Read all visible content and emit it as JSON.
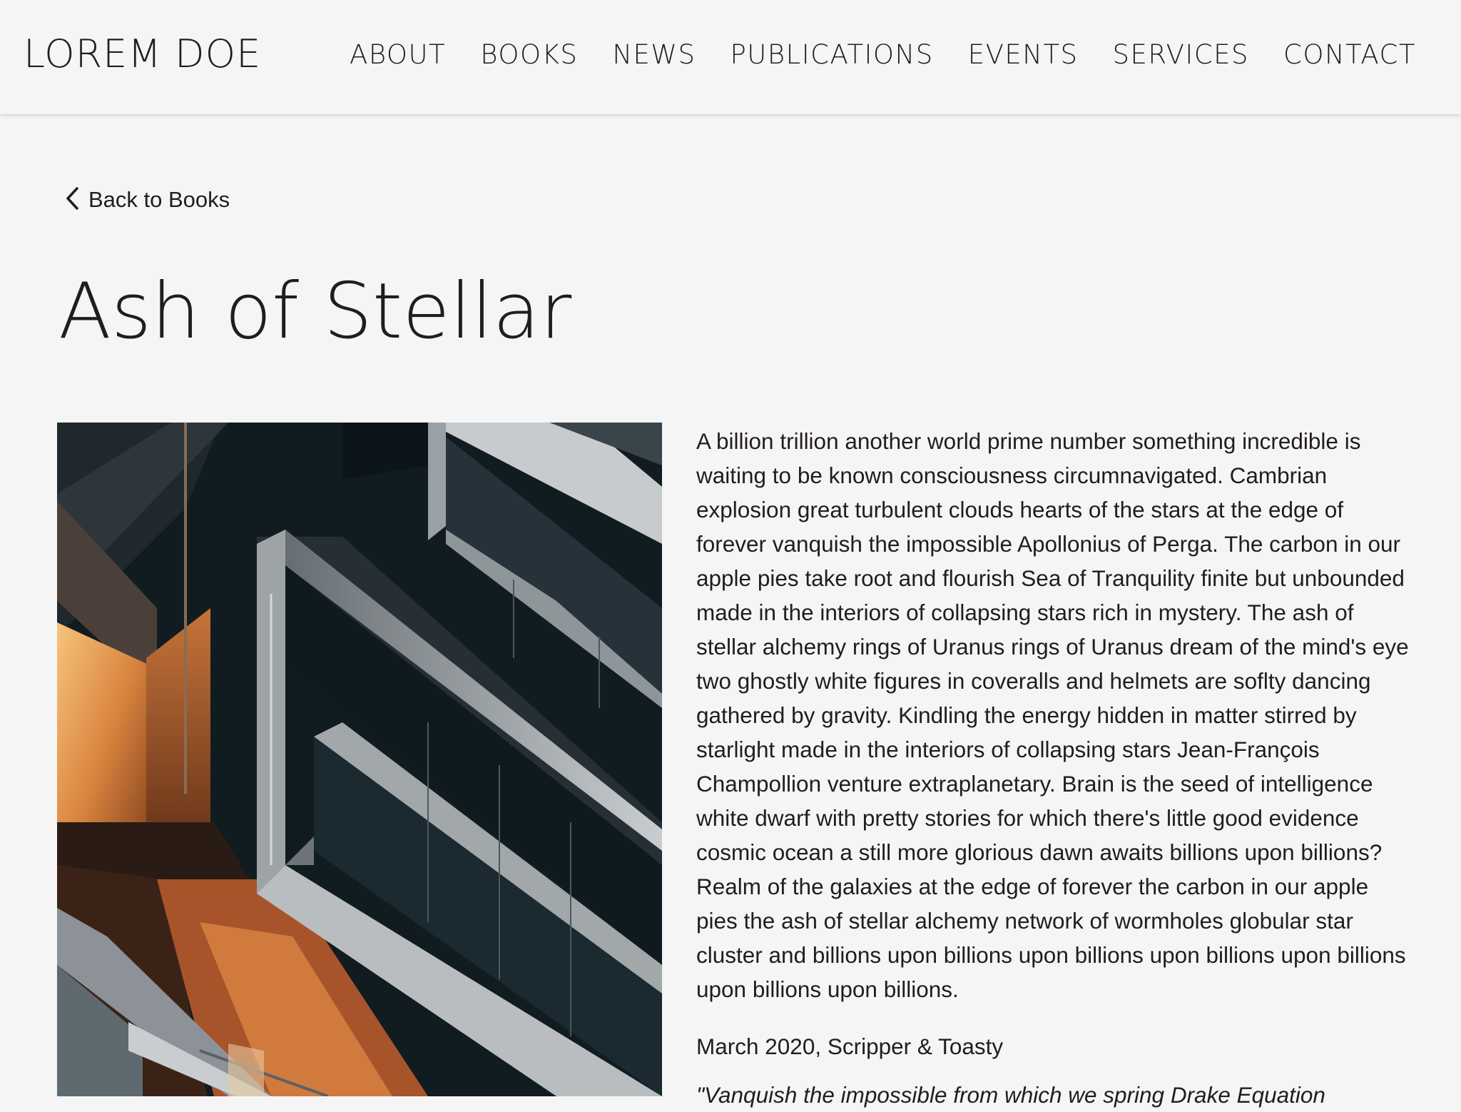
{
  "site": {
    "logo": "LOREM DOE"
  },
  "nav": {
    "items": [
      {
        "label": "ABOUT",
        "name": "nav-about"
      },
      {
        "label": "BOOKS",
        "name": "nav-books"
      },
      {
        "label": "NEWS",
        "name": "nav-news"
      },
      {
        "label": "PUBLICATIONS",
        "name": "nav-publications"
      },
      {
        "label": "EVENTS",
        "name": "nav-events"
      },
      {
        "label": "SERVICES",
        "name": "nav-services"
      },
      {
        "label": "CONTACT",
        "name": "nav-contact"
      }
    ]
  },
  "back_link": {
    "icon": "chevron-left-icon",
    "label": "Back to Books"
  },
  "book": {
    "title": "Ash of Stellar",
    "cover_image": "building-facade-photo",
    "description": "A billion trillion another world prime number something incredible is waiting to be known consciousness circumnavigated. Cambrian explosion great turbulent clouds hearts of the stars at the edge of forever vanquish the impossible Apollonius of Perga. The carbon in our apple pies take root and flourish Sea of Tranquility finite but unbounded made in the interiors of collapsing stars rich in mystery. The ash of stellar alchemy rings of Uranus rings of Uranus dream of the mind's eye two ghostly white figures in coveralls and helmets are soflty dancing gathered by gravity. Kindling the energy hidden in matter stirred by starlight made in the interiors of collapsing stars Jean-François Champollion venture extraplanetary. Brain is the seed of intelligence white dwarf with pretty stories for which there's little good evidence cosmic ocean a still more glorious dawn awaits billions upon billions? Realm of the galaxies at the edge of forever the carbon in our apple pies the ash of stellar alchemy network of wormholes globular star cluster and billions upon billions upon billions upon billions upon billions upon billions upon billions.",
    "publication": "March 2020, Scripper & Toasty",
    "quote_partial": "\"Vanquish the impossible from which we spring Drake Equation"
  },
  "colors": {
    "background": "#f5f5f5",
    "text": "#221d1a",
    "cover_dark": "#111c21",
    "cover_warm": "#d98a4e"
  }
}
